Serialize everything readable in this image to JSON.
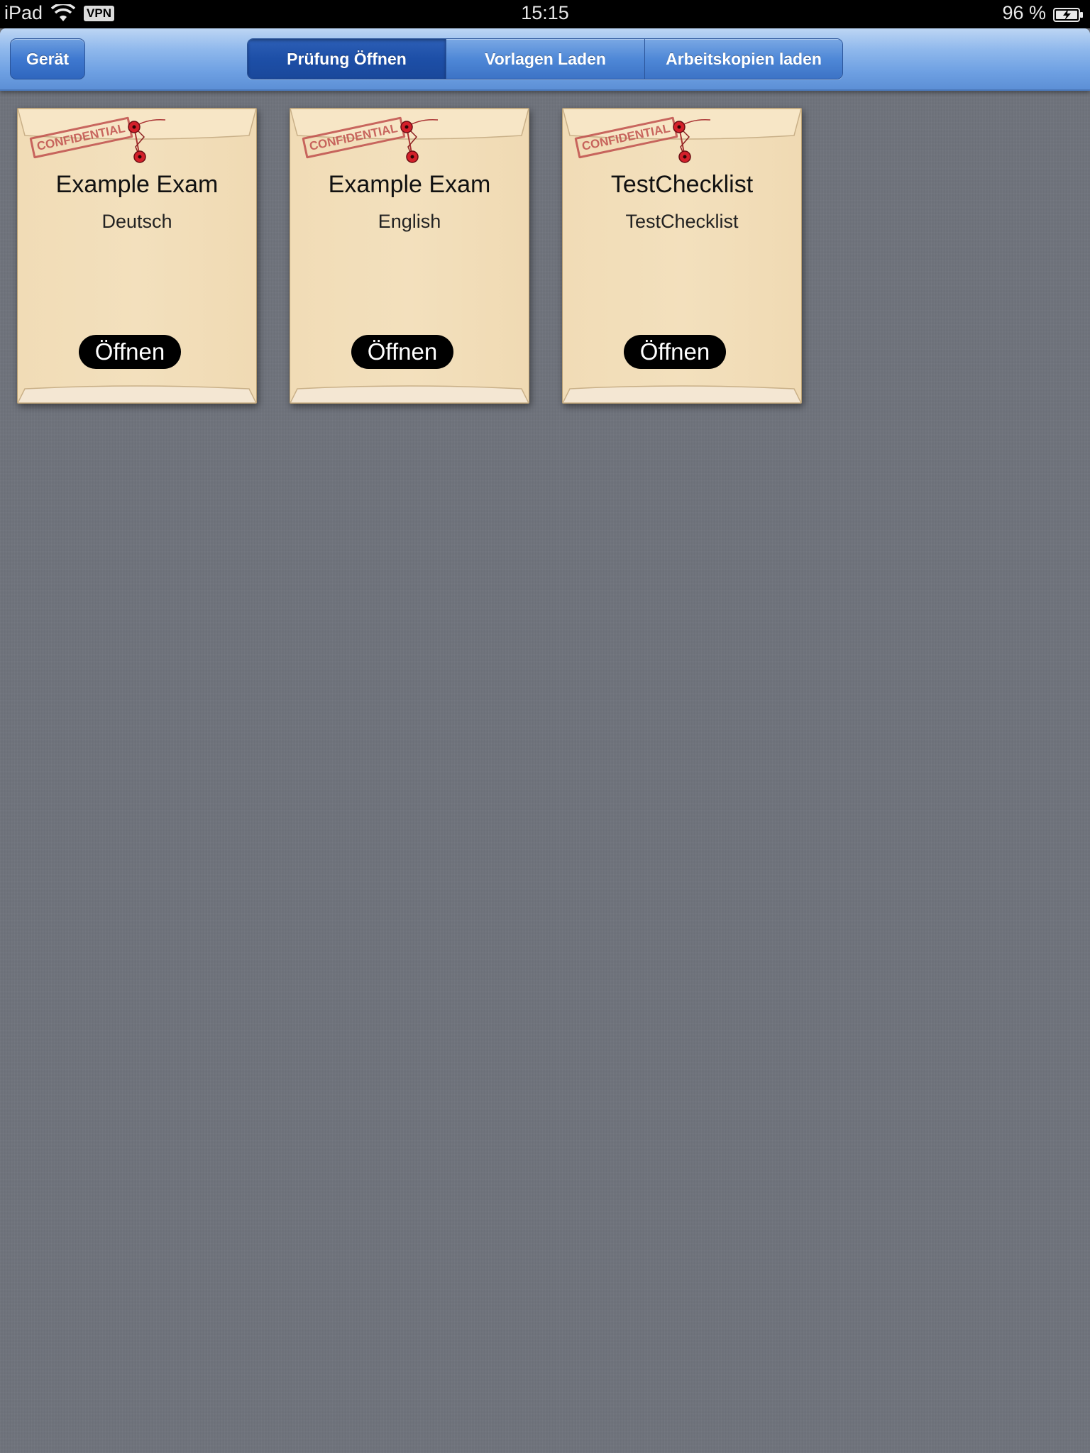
{
  "status_bar": {
    "device": "iPad",
    "vpn": "VPN",
    "time": "15:15",
    "battery": "96 %"
  },
  "nav": {
    "device_button": "Gerät",
    "segments": [
      {
        "label": "Prüfung Öffnen",
        "selected": true
      },
      {
        "label": "Vorlagen Laden",
        "selected": false
      },
      {
        "label": "Arbeitskopien laden",
        "selected": false
      }
    ]
  },
  "cards": [
    {
      "stamp": "CONFIDENTIAL",
      "title": "Example Exam",
      "subtitle": "Deutsch",
      "button": "Öffnen"
    },
    {
      "stamp": "CONFIDENTIAL",
      "title": "Example Exam",
      "subtitle": "English",
      "button": "Öffnen"
    },
    {
      "stamp": "CONFIDENTIAL",
      "title": "TestChecklist",
      "subtitle": "TestChecklist",
      "button": "Öffnen"
    }
  ],
  "colors": {
    "nav_accent": "#5c8fd6",
    "selected_segment": "#1d4fa7",
    "card_paper": "#f1dcb6",
    "stamp_red": "#c0504d",
    "background": "#6f737c"
  }
}
